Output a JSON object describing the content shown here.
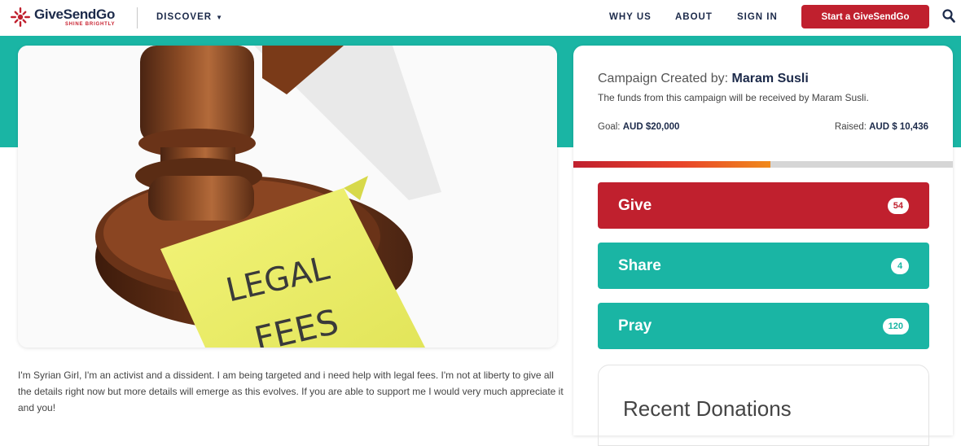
{
  "header": {
    "logo_title": "GiveSendGo",
    "logo_tagline": "SHINE BRIGHTLY",
    "discover_label": "DISCOVER",
    "nav": [
      {
        "label": "WHY US"
      },
      {
        "label": "ABOUT"
      },
      {
        "label": "SIGN IN"
      }
    ],
    "start_label": "Start a GiveSendGo",
    "icons": [
      "givesendgo-logo-icon",
      "chevron-down-icon",
      "search-icon"
    ]
  },
  "campaign": {
    "image_text": [
      "LEGAL",
      "FEES"
    ],
    "description": "I'm Syrian Girl, I'm an activist and a dissident. I am being targeted and i need help with legal fees. I'm not at liberty to give all the details right now but more details will emerge as this evolves. If you are able to support me I would very much appreciate it and you!"
  },
  "panel": {
    "creator_prefix": "Campaign Created by:",
    "creator_name": "Maram Susli",
    "funds_note": "The funds from this campaign will be received by Maram Susli.",
    "goal_label": "Goal:",
    "goal_value": "AUD $20,000",
    "raised_label": "Raised:",
    "raised_value": "AUD $ 10,436",
    "progress_fraction": 0.52,
    "actions": [
      {
        "label": "Give",
        "count": "54"
      },
      {
        "label": "Share",
        "count": "4"
      },
      {
        "label": "Pray",
        "count": "120"
      }
    ],
    "recent_title": "Recent Donations"
  },
  "colors": {
    "brand_red": "#c0202e",
    "teal": "#1ab5a4",
    "navy": "#1c2a4a"
  }
}
